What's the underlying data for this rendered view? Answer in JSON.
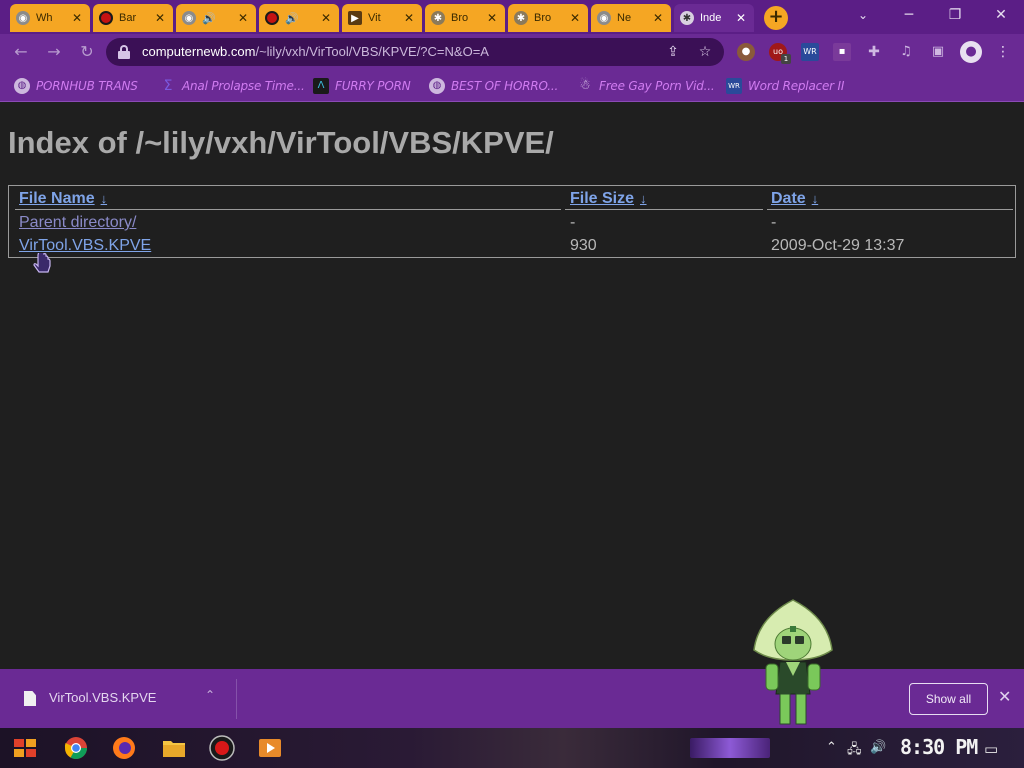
{
  "browser": {
    "tabs": [
      {
        "title": "Wh",
        "favicon": "chrome-icon",
        "active": false
      },
      {
        "title": "Bar",
        "favicon": "record-icon",
        "active": false
      },
      {
        "title": "",
        "favicon": "chrome-icon",
        "audio": true,
        "active": false
      },
      {
        "title": "",
        "favicon": "record-icon",
        "audio": true,
        "active": false
      },
      {
        "title": "Vit",
        "favicon": "play-icon",
        "active": false
      },
      {
        "title": "Bro",
        "favicon": "alien-icon",
        "active": false
      },
      {
        "title": "Bro",
        "favicon": "alien-icon",
        "active": false
      },
      {
        "title": "Ne",
        "favicon": "chrome-icon",
        "active": false
      },
      {
        "title": "Inde",
        "favicon": "alien-icon",
        "active": true
      }
    ],
    "new_tab_label": "+",
    "url_host": "computernewb.com",
    "url_path": "/~lily/vxh/VirTool/VBS/KPVE/?C=N&O=A",
    "bookmarks": [
      {
        "label": "PORNHUB TRANS",
        "icon": "globe-icon"
      },
      {
        "label": "Anal Prolapse Time...",
        "icon": "sigma-icon"
      },
      {
        "label": "FURRY PORN",
        "icon": "arrow-icon"
      },
      {
        "label": "BEST OF HORRO...",
        "icon": "globe-icon"
      },
      {
        "label": "Free Gay Porn Vid...",
        "icon": "robot-icon"
      },
      {
        "label": "Word Replacer II",
        "icon": "wr-icon"
      }
    ],
    "extension_badge": "1"
  },
  "page": {
    "title": "Index of /~lily/vxh/VirTool/VBS/KPVE/",
    "columns": {
      "name": "File Name",
      "size": "File Size",
      "date": "Date",
      "sort_arrow": "↓"
    },
    "rows": [
      {
        "name": "Parent directory/",
        "size": "-",
        "date": "-"
      },
      {
        "name": "VirTool.VBS.KPVE",
        "size": "930",
        "date": "2009-Oct-29 13:37"
      }
    ]
  },
  "download_bar": {
    "file_name": "VirTool.VBS.KPVE",
    "show_all_label": "Show all"
  },
  "taskbar": {
    "clock": "8:30 PM"
  },
  "colors": {
    "theme_purple": "#6a2a94",
    "tab_orange": "#f5a623",
    "link_blue": "#7fa4e8",
    "page_bg": "#1f1f1f"
  }
}
